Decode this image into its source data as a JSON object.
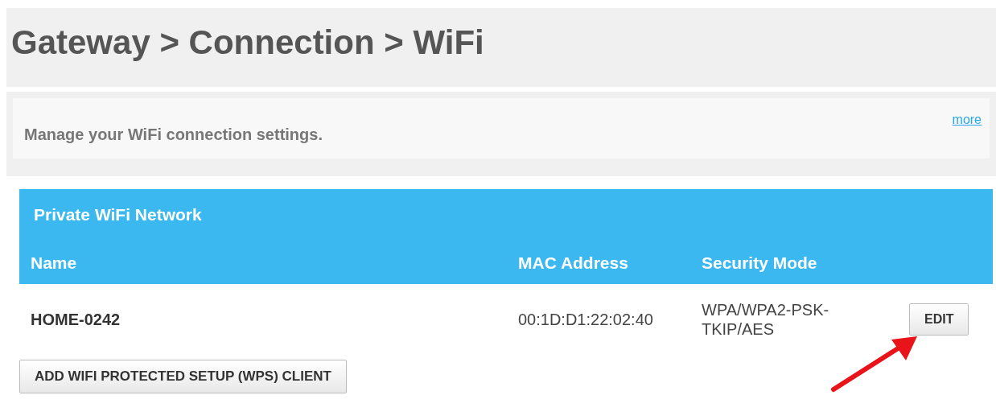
{
  "breadcrumb": "Gateway > Connection > WiFi",
  "description": {
    "text": "Manage your WiFi connection settings.",
    "more_link": "more"
  },
  "network_panel": {
    "title": "Private WiFi Network",
    "columns": [
      "Name",
      "MAC Address",
      "Security Mode"
    ],
    "rows": [
      {
        "name": "HOME-0242",
        "mac": "00:1D:D1:22:02:40",
        "security": "WPA/WPA2-PSK-TKIP/AES",
        "action": "EDIT"
      }
    ]
  },
  "add_button": "ADD WIFI PROTECTED SETUP (WPS) CLIENT"
}
